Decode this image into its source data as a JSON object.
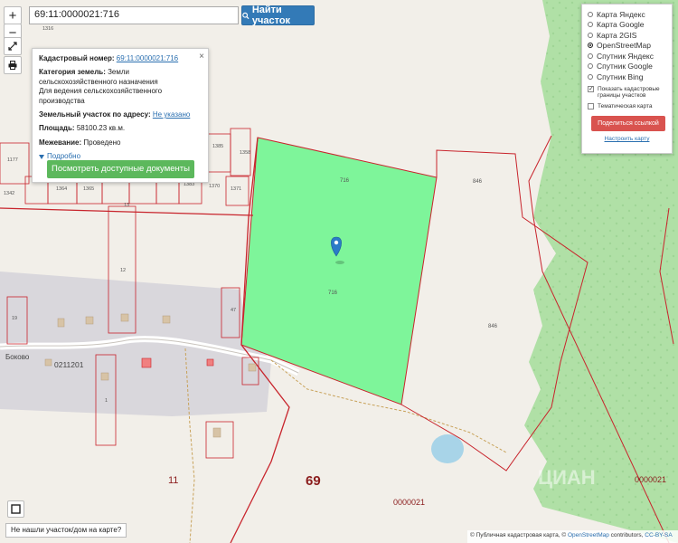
{
  "search": {
    "value": "69:11:0000021:716",
    "button_label": "Найти участок"
  },
  "zoom": {
    "in_label": "+",
    "out_label": "−"
  },
  "info_panel": {
    "cadastral_label": "Кадастровый номер:",
    "cadastral_value": "69:11:0000021:716",
    "category_label": "Категория земель:",
    "category_value": "Земли сельскохозяйственного назначения",
    "usage_value": "Для ведения сельскохозяйственного производства",
    "address_label": "Земельный участок по адресу:",
    "address_value": "Не указано",
    "area_label": "Площадь:",
    "area_value": "58100.23 кв.м.",
    "survey_label": "Межевание:",
    "survey_value": "Проведено",
    "more_label": "Подробно",
    "docs_button": "Посмотреть доступные документы",
    "close_label": "×"
  },
  "layers_panel": {
    "layers": [
      {
        "label": "Карта Яндекс",
        "selected": false
      },
      {
        "label": "Карта Google",
        "selected": false
      },
      {
        "label": "Карта 2GIS",
        "selected": false
      },
      {
        "label": "OpenStreetMap",
        "selected": true
      },
      {
        "label": "Спутник Яндекс",
        "selected": false
      },
      {
        "label": "Спутник Google",
        "selected": false
      },
      {
        "label": "Спутник Bing",
        "selected": false
      }
    ],
    "show_boundaries_label": "Показать кадастровые границы участков",
    "show_boundaries_checked": true,
    "thematic_label": "Тематическая карта",
    "thematic_checked": false,
    "share_button": "Поделиться ссылкой",
    "configure_link": "Настроить карту"
  },
  "map_labels": {
    "parcel_716_top": "716",
    "parcel_716_center": "716",
    "parcel_846_top": "846",
    "parcel_846_mid": "846",
    "village": "Боково",
    "block_code": "0211201",
    "region_number": "69",
    "district_number": "11",
    "quarter_code": "0000021",
    "quarter_code_right": "0000021",
    "watermark": "ЦИАН",
    "plot_numbers": [
      "1316",
      "1177",
      "1342",
      "1364",
      "1365",
      "1385",
      "1358",
      "1370",
      "1371",
      "1383",
      "13",
      "12",
      "19",
      "1",
      "47"
    ]
  },
  "bottom": {
    "not_found_label": "Не нашли участок/дом на карте?",
    "attribution_prefix": "© Публичная кадастровая карта, ©",
    "attribution_osm": "OpenStreetMap",
    "attribution_mid": "contributors,",
    "attribution_license": "CC-BY-SA"
  },
  "colors": {
    "selected_parcel": "#7ef59a",
    "forest": "#b0e0a6",
    "boundary": "#c8242c",
    "settlement": "#d9d7dc",
    "water": "#a8d4e8",
    "marker": "#2b7bc7"
  },
  "icons": [
    "search-icon",
    "fullscreen-icon",
    "print-icon",
    "layers-toggle-icon",
    "close-icon",
    "chevron-down-icon",
    "map-marker-icon"
  ]
}
